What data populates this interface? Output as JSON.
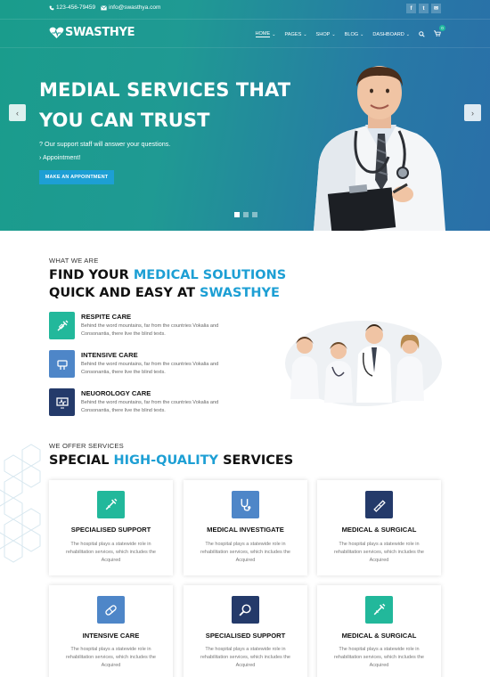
{
  "topbar": {
    "phone": "123-456-79459",
    "email": "info@swasthya.com",
    "social": [
      {
        "icon": "facebook-icon",
        "glyph": "f"
      },
      {
        "icon": "twitter-icon",
        "glyph": "t"
      },
      {
        "icon": "email-icon",
        "glyph": "✉"
      }
    ]
  },
  "brand": {
    "name": "SWASTHYE"
  },
  "nav": {
    "items": [
      {
        "label": "HOME",
        "caret": "⌄"
      },
      {
        "label": "PAGES",
        "caret": "⌄"
      },
      {
        "label": "SHOP",
        "caret": "⌄"
      },
      {
        "label": "BLOG",
        "caret": "⌄"
      },
      {
        "label": "DASHBOARD",
        "caret": "⌄"
      }
    ],
    "cart_count": "0"
  },
  "slider": {
    "title_line1": "MEDIAL SERVICES THAT",
    "title_line2": "YOU CAN TRUST",
    "line1": "? Our support staff will answer your questions.",
    "line2": "› Appointment!",
    "cta": "MAKE AN APPOINTMENT",
    "prev": "‹",
    "next": "›",
    "slide_count": 3,
    "active_slide": 1
  },
  "about": {
    "eyebrow": "WHAT WE ARE",
    "title_a": "FIND YOUR ",
    "title_hl": "MEDICAL SOLUTIONS",
    "title_b": "QUICK AND EASY AT ",
    "title_hl2": "SWASTHYE",
    "features": [
      {
        "title": "RESPITE CARE",
        "desc_1": "Behind the word mountains, far from the countries Vokalia and",
        "desc_2": "Consonantia, there live the blind texts.",
        "color": "#22b89b",
        "icon": "syringe-icon"
      },
      {
        "title": "INTENSIVE CARE",
        "desc_1": "Behind the word mountains, far from the countries Vokalia and",
        "desc_2": "Consonantia, there live the blind texts.",
        "color": "#4e86c8",
        "icon": "bandage-icon"
      },
      {
        "title": "NEUOROLOGY CARE",
        "desc_1": "Behind the word mountains, far from the countries Vokalia and",
        "desc_2": "Consonantia, there live the blind texts.",
        "color": "#243a6a",
        "icon": "monitor-icon"
      }
    ]
  },
  "services": {
    "eyebrow": "WE OFFER SERVICES",
    "title_a": "SPECIAL ",
    "title_hl": "HIGH-QUALITY",
    "title_b": " SERVICES",
    "cards": [
      {
        "title": "SPECIALISED SUPPORT",
        "d1": "The hospital plays a statewide role in",
        "d2": "rehabilitation services, which includes the",
        "d3": "Acquired",
        "color": "#22b89b",
        "icon": "syringe-icon"
      },
      {
        "title": "MEDICAL INVESTIGATE",
        "d1": "The hospital plays a statewide role in",
        "d2": "rehabilitation services, which includes the",
        "d3": "Acquired",
        "color": "#4e86c8",
        "icon": "stethoscope-icon"
      },
      {
        "title": "MEDICAL & SURGICAL",
        "d1": "The hospital plays a statewide role in",
        "d2": "rehabilitation services, which includes the",
        "d3": "Acquired",
        "color": "#243a6a",
        "icon": "scalpel-icon"
      },
      {
        "title": "INTENSIVE CARE",
        "d1": "The hospital plays a statewide role in",
        "d2": "rehabilitation services, which includes the",
        "d3": "Acquired",
        "color": "#4e86c8",
        "icon": "pills-icon"
      },
      {
        "title": "SPECIALISED SUPPORT",
        "d1": "The hospital plays a statewide role in",
        "d2": "rehabilitation services, which includes the",
        "d3": "Acquired",
        "color": "#243a6a",
        "icon": "magnifier-icon"
      },
      {
        "title": "MEDICAL & SURGICAL",
        "d1": "The hospital plays a statewide role in",
        "d2": "rehabilitation services, which includes the",
        "d3": "Acquired",
        "color": "#22b89b",
        "icon": "syringe-icon"
      }
    ]
  }
}
